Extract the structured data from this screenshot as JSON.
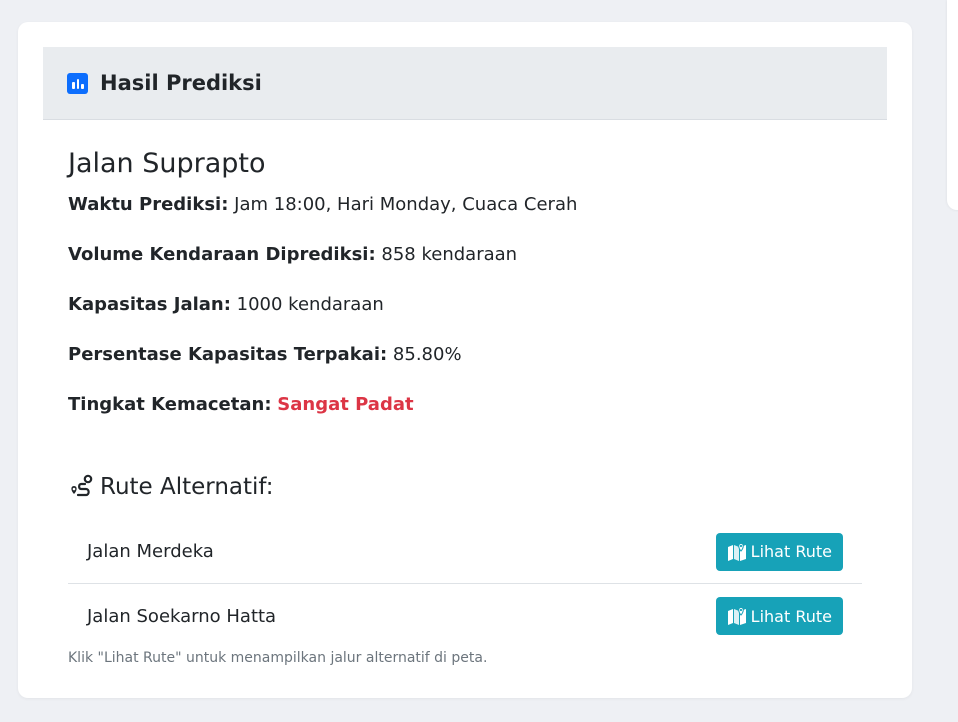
{
  "header": {
    "icon": "bar-chart-icon",
    "title": "Hasil Prediksi"
  },
  "prediction": {
    "road_name": "Jalan Suprapto",
    "time": {
      "label": "Waktu Prediksi:",
      "value": "Jam 18:00, Hari Monday, Cuaca Cerah"
    },
    "volume": {
      "label": "Volume Kendaraan Diprediksi:",
      "value": "858 kendaraan"
    },
    "capacity": {
      "label": "Kapasitas Jalan:",
      "value": "1000 kendaraan"
    },
    "usage": {
      "label": "Persentase Kapasitas Terpakai:",
      "value": "85.80%"
    },
    "congestion": {
      "label": "Tingkat Kemacetan:",
      "value": "Sangat Padat",
      "color": "#dc3545"
    }
  },
  "alternatives": {
    "icon": "route-icon",
    "title": "Rute Alternatif:",
    "routes": [
      {
        "name": "Jalan Merdeka",
        "button_label": "Lihat Rute",
        "button_icon": "map-icon"
      },
      {
        "name": "Jalan Soekarno Hatta",
        "button_label": "Lihat Rute",
        "button_icon": "map-icon"
      }
    ],
    "note": "Klik \"Lihat Rute\" untuk menampilkan jalur alternatif di peta."
  },
  "colors": {
    "primary": "#0d6efd",
    "info": "#17a2b8",
    "danger": "#dc3545",
    "header_bg": "#e9ecef"
  }
}
